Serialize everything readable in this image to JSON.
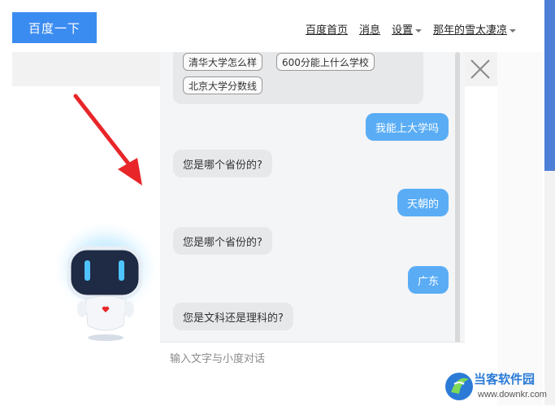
{
  "header": {
    "search_button": "百度一下",
    "nav": [
      "百度首页",
      "消息",
      "设置",
      "那年的雪太凄凉"
    ]
  },
  "chat": {
    "suggestions": [
      "清华大学怎么样",
      "600分能上什么学校",
      "北京大学分数线"
    ],
    "messages": [
      {
        "side": "right",
        "text": "我能上大学吗"
      },
      {
        "side": "left",
        "text": "您是哪个省份的?"
      },
      {
        "side": "right",
        "text": "天朝的"
      },
      {
        "side": "left",
        "text": "您是哪个省份的?"
      },
      {
        "side": "right",
        "text": "广东"
      },
      {
        "side": "left",
        "text": "您是文科还是理科的?"
      }
    ],
    "input_placeholder": "输入文字与小度对话"
  },
  "watermark": {
    "title": "当客软件园",
    "url": "www.downkr.com"
  },
  "colors": {
    "primary": "#3b8cf0",
    "user_bubble": "#5aadf5",
    "bot_bubble": "#e7e8ea",
    "arrow": "#e8262a"
  }
}
